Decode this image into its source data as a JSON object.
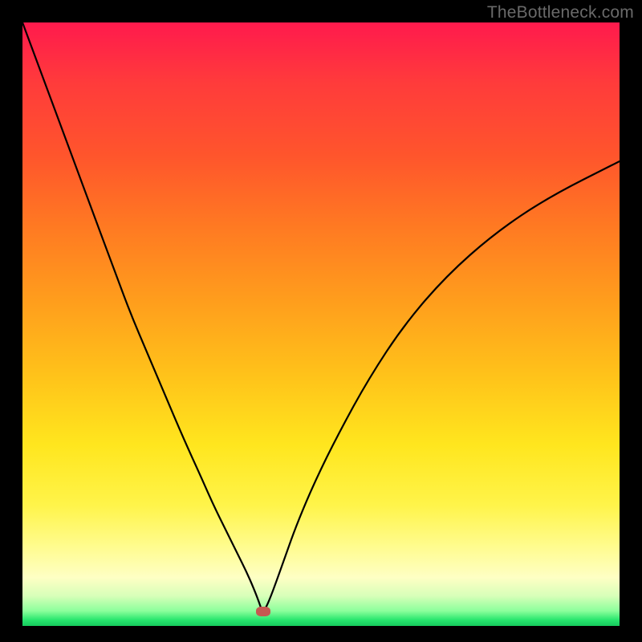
{
  "watermark": "TheBottleneck.com",
  "marker": {
    "x_pct": 40.3,
    "y_pct": 97.6
  },
  "chart_data": {
    "type": "line",
    "title": "",
    "xlabel": "",
    "ylabel": "",
    "xlim": [
      0,
      100
    ],
    "ylim": [
      0,
      100
    ],
    "grid": false,
    "legend": false,
    "annotations": [
      {
        "type": "marker",
        "x": 40.3,
        "y": 2.4,
        "shape": "rounded-rect",
        "color": "#c65851"
      }
    ],
    "background_gradient": [
      "#ff1a4d",
      "#ffe61e",
      "#16c95d"
    ],
    "series": [
      {
        "name": "bottleneck-curve",
        "x": [
          0.0,
          3.0,
          6.0,
          9.0,
          12.0,
          15.0,
          18.0,
          21.0,
          24.0,
          27.0,
          30.0,
          32.0,
          34.0,
          36.0,
          37.5,
          38.7,
          39.6,
          40.0,
          40.3,
          40.7,
          41.4,
          42.5,
          44.0,
          46.0,
          49.0,
          53.0,
          58.0,
          64.0,
          71.0,
          79.0,
          88.0,
          100.0
        ],
        "y": [
          100.0,
          92.0,
          84.0,
          76.0,
          68.0,
          60.0,
          52.0,
          45.0,
          38.0,
          31.0,
          24.5,
          20.0,
          16.0,
          12.0,
          9.0,
          6.3,
          4.0,
          2.8,
          2.4,
          2.9,
          4.4,
          7.3,
          11.5,
          17.0,
          24.0,
          32.0,
          41.0,
          50.0,
          58.0,
          65.0,
          71.0,
          77.0
        ]
      }
    ]
  }
}
